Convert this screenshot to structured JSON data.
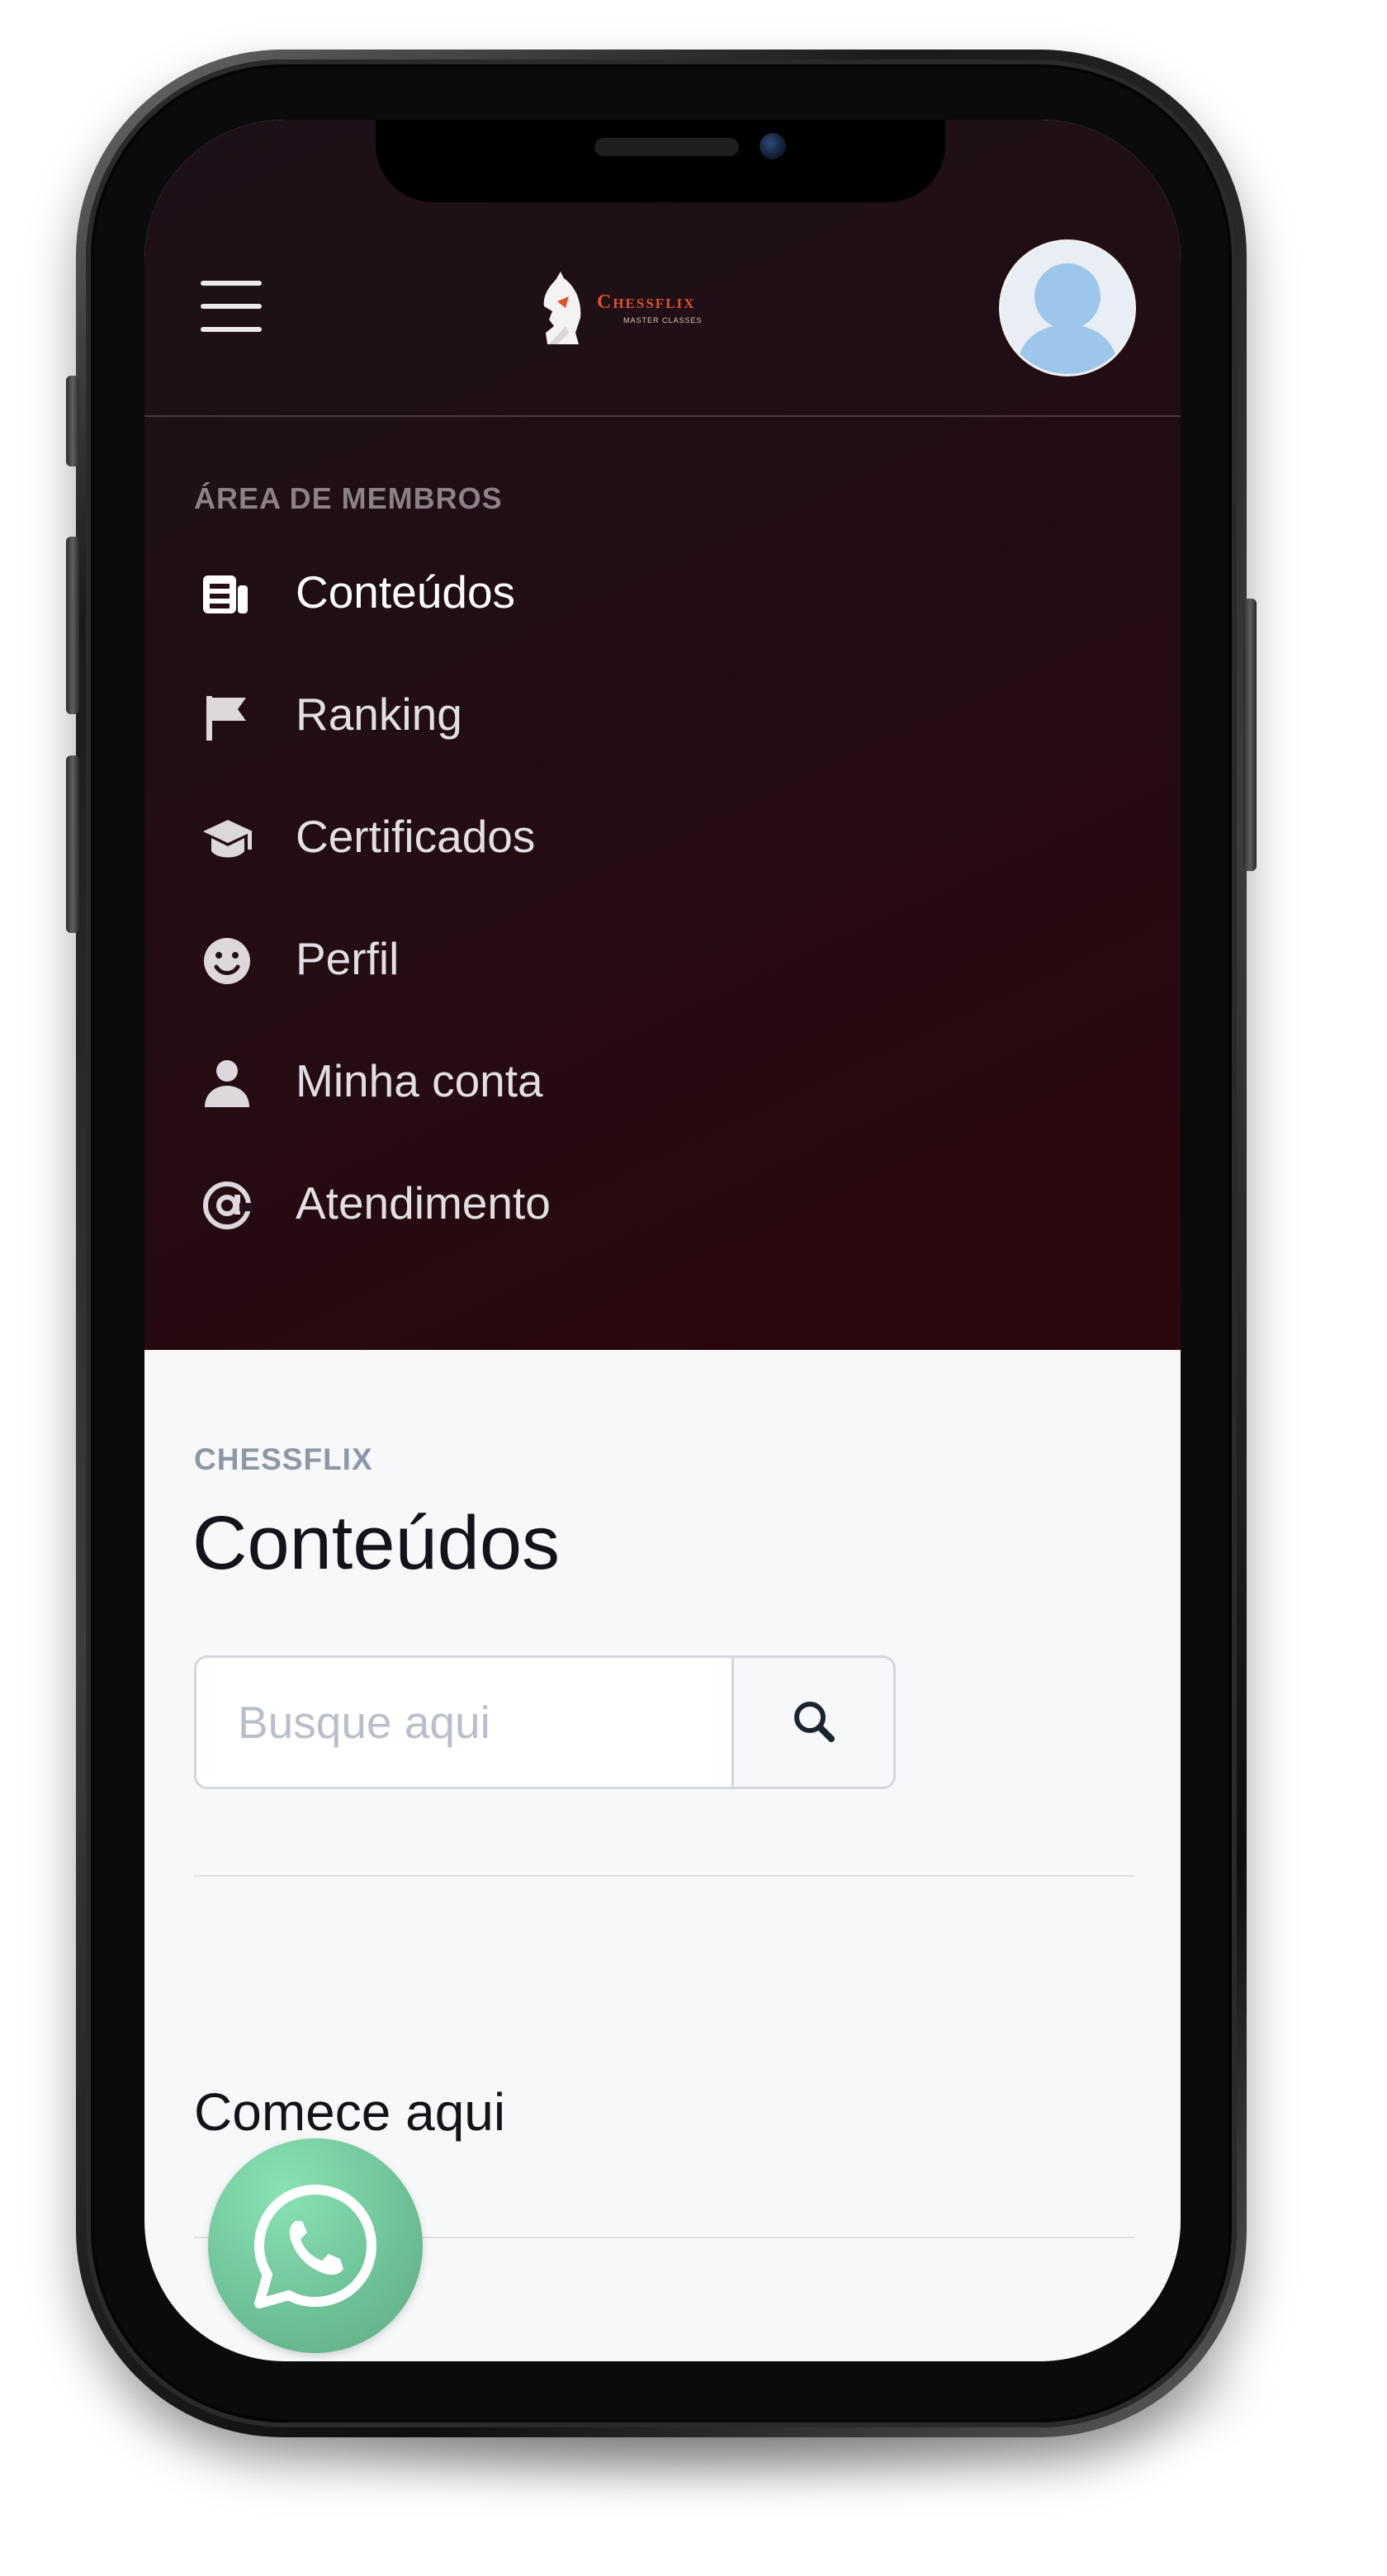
{
  "header": {
    "logo_text": "Chessflix",
    "logo_subtext": "MASTER CLASSES"
  },
  "sidebar": {
    "section_label": "ÁREA DE MEMBROS",
    "items": [
      {
        "label": "Conteúdos",
        "icon": "news-icon",
        "active": true
      },
      {
        "label": "Ranking",
        "icon": "flag-icon",
        "active": false
      },
      {
        "label": "Certificados",
        "icon": "graduation-cap-icon",
        "active": false
      },
      {
        "label": "Perfil",
        "icon": "smiley-icon",
        "active": false
      },
      {
        "label": "Minha conta",
        "icon": "person-icon",
        "active": false
      },
      {
        "label": "Atendimento",
        "icon": "at-sign-icon",
        "active": false
      }
    ]
  },
  "main": {
    "breadcrumb": "CHESSFLIX",
    "title": "Conteúdos",
    "search": {
      "placeholder": "Busque aqui",
      "value": ""
    },
    "section_heading": "Comece aqui"
  },
  "floating": {
    "whatsapp_icon": "whatsapp-icon"
  },
  "colors": {
    "header_bg": "#1c1118",
    "accent_logo": "#e0522c",
    "content_bg": "#f7f8fa",
    "whatsapp_green": "#6fc398"
  }
}
